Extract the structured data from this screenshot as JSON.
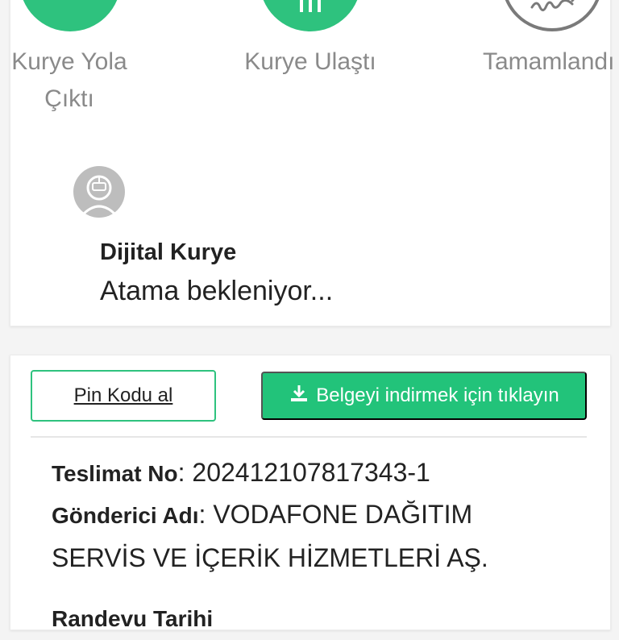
{
  "steps": [
    {
      "label_line1": "Kurye Yola",
      "label_line2": "Çıktı"
    },
    {
      "label_line1": "Kurye Ulaştı"
    },
    {
      "label_line1": "Tamamlandı"
    }
  ],
  "courier": {
    "name": "Dijital Kurye",
    "status": "Atama bekleniyor..."
  },
  "buttons": {
    "pin_label": "Pin Kodu al",
    "download_label": "Belgeyi indirmek için tıklayın"
  },
  "details": {
    "delivery_no_label": "Teslimat No",
    "delivery_no_value": "202412107817343-1",
    "sender_label": "Gönderici Adı",
    "sender_value_line1": "VODAFONE DAĞITIM",
    "sender_value_line2": "SERVİS VE İÇERİK HİZMETLERİ AŞ.",
    "appointment_label": "Randevu Tarihi",
    "separator": ":"
  },
  "colors": {
    "accent": "#2ec27e",
    "outline_gray": "#7a7a7a"
  },
  "icons": {
    "step1": "step-complete-icon",
    "step2": "building-icon",
    "step3": "signature-icon",
    "avatar": "courier-avatar-icon",
    "download": "download-icon"
  }
}
